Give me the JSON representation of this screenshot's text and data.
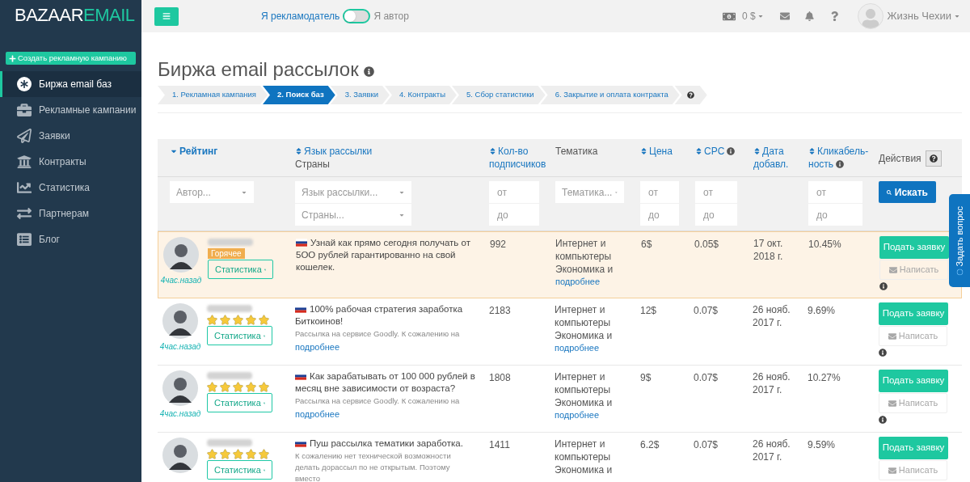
{
  "sidebar": {
    "logo": {
      "main": "BAZAAR",
      "accent": "EMAIL"
    },
    "create_button": "Создать рекламную кампанию",
    "items": [
      {
        "label": "Биржа email баз",
        "selected": true
      },
      {
        "label": "Рекламные кампании",
        "selected": false
      },
      {
        "label": "Заявки",
        "selected": false
      },
      {
        "label": "Контракты",
        "selected": false
      },
      {
        "label": "Статистика",
        "selected": false
      },
      {
        "label": "Партнерам",
        "selected": false
      },
      {
        "label": "Блог",
        "selected": false
      }
    ]
  },
  "topbar": {
    "toggle": {
      "left_label": "Я рекламодатель",
      "right_label": "Я автор",
      "on": false
    },
    "balance": "0 $",
    "user": "Жизнь Чехии"
  },
  "page_title": "Биржа email рассылок",
  "steps": [
    {
      "label": "1. Рекламная кампания",
      "selected": false
    },
    {
      "label": "2. Поиск баз",
      "selected": true
    },
    {
      "label": "3. Заявки",
      "selected": false
    },
    {
      "label": "4. Контракты",
      "selected": false
    },
    {
      "label": "5. Сбор статистики",
      "selected": false
    },
    {
      "label": "6. Закрытие и оплата контракта",
      "selected": false
    }
  ],
  "table": {
    "columns": [
      {
        "lines": [
          "Рейтинг"
        ],
        "sortable": true,
        "sorted": true,
        "filters": [
          {
            "kind": "select",
            "placeholder": "Автор..."
          }
        ]
      },
      {
        "lines": [
          "Язык рассылки"
        ],
        "sublabel": "Страны",
        "sortable": true,
        "sorted": false,
        "filters": [
          {
            "kind": "select",
            "placeholder": "Язык рассылки..."
          },
          {
            "kind": "select",
            "placeholder": "Страны..."
          }
        ]
      },
      {
        "lines": [
          "Кол-во",
          "подписчиков"
        ],
        "sortable": true,
        "sorted": false,
        "filters": [
          {
            "kind": "input",
            "placeholder": "от"
          },
          {
            "kind": "input",
            "placeholder": "до"
          }
        ]
      },
      {
        "lines": [
          "Тематика"
        ],
        "sortable": false,
        "filters": [
          {
            "kind": "select",
            "placeholder": "Тематика..."
          }
        ]
      },
      {
        "lines": [
          "Цена"
        ],
        "sortable": true,
        "sorted": false,
        "filters": [
          {
            "kind": "input",
            "placeholder": "от"
          },
          {
            "kind": "input",
            "placeholder": "до"
          }
        ]
      },
      {
        "lines": [
          "CPC"
        ],
        "sortable": true,
        "sorted": false,
        "info": true,
        "filters": [
          {
            "kind": "input",
            "placeholder": "от"
          },
          {
            "kind": "input",
            "placeholder": "до"
          }
        ]
      },
      {
        "lines": [
          "Дата",
          "добавл."
        ],
        "sortable": true,
        "sorted": false
      },
      {
        "lines": [
          "Кликабель-",
          "ность"
        ],
        "sortable": true,
        "sorted": false,
        "info": true,
        "filters": [
          {
            "kind": "input",
            "placeholder": "от"
          },
          {
            "kind": "input",
            "placeholder": "до"
          }
        ]
      },
      {
        "lines": [
          "Действия"
        ],
        "sortable": false,
        "help": true,
        "filters": [
          {
            "kind": "button",
            "label": "Искать"
          }
        ]
      }
    ],
    "rows": [
      {
        "highlighted": true,
        "badge": "Горячее",
        "time": "4час.назад",
        "stats": "Статистика",
        "title": "Узнай как прямо сегодня получать от 5OO рублей гарантированно на свой кошелек.",
        "subscribers": "992",
        "theme": "Интернет и компьютеры Экономика и",
        "theme_more": "подробнее",
        "price": "6$",
        "cpc": "0.05$",
        "date": "17 окт. 2018 г.",
        "ctr": "10.45%",
        "apply": "Подать заявку",
        "write": "Написать",
        "write_disabled": true
      },
      {
        "highlighted": false,
        "stars": 5,
        "time": "4час.назад",
        "stats": "Статистика",
        "title": "100% рабочая стратегия заработка Биткоинов!",
        "description": "Рассылка на сервисе Goodly. К сожалению на",
        "more": "подробнее",
        "subscribers": "2183",
        "theme": "Интернет и компьютеры Экономика и",
        "theme_more": "подробнее",
        "price": "12$",
        "cpc": "0.07$",
        "date": "26 нояб. 2017 г.",
        "ctr": "9.69%",
        "apply": "Подать заявку",
        "write": "Написать",
        "write_disabled": true
      },
      {
        "highlighted": false,
        "stars": 5,
        "time": "4час.назад",
        "stats": "Статистика",
        "title": "Как зарабатывать от 100 000 рублей в месяц вне зависимости от возраста?",
        "description": "Рассылка на сервисе Goodly. К сожалению на",
        "more": "подробнее",
        "subscribers": "1808",
        "theme": "Интернет и компьютеры Экономика и",
        "theme_more": "подробнее",
        "price": "9$",
        "cpc": "0.07$",
        "date": "26 нояб. 2017 г.",
        "ctr": "10.27%",
        "apply": "Подать заявку",
        "write": "Написать",
        "write_disabled": true
      },
      {
        "highlighted": false,
        "stars": 5,
        "stats": "Статистика",
        "title": "Пуш рассылка тематики заработка.",
        "description": "К сожалению нет технической возможности делать дорассыл по не открытым. Поэтому вместо",
        "subscribers": "1411",
        "theme": "Интернет и компьютеры Экономика и",
        "price": "6.2$",
        "cpc": "0.07$",
        "date": "26 нояб. 2017 г.",
        "ctr": "9.59%",
        "apply": "Подать заявку",
        "write": "Написать",
        "write_disabled": true
      }
    ]
  },
  "ask_tab": "Задать вопрос"
}
